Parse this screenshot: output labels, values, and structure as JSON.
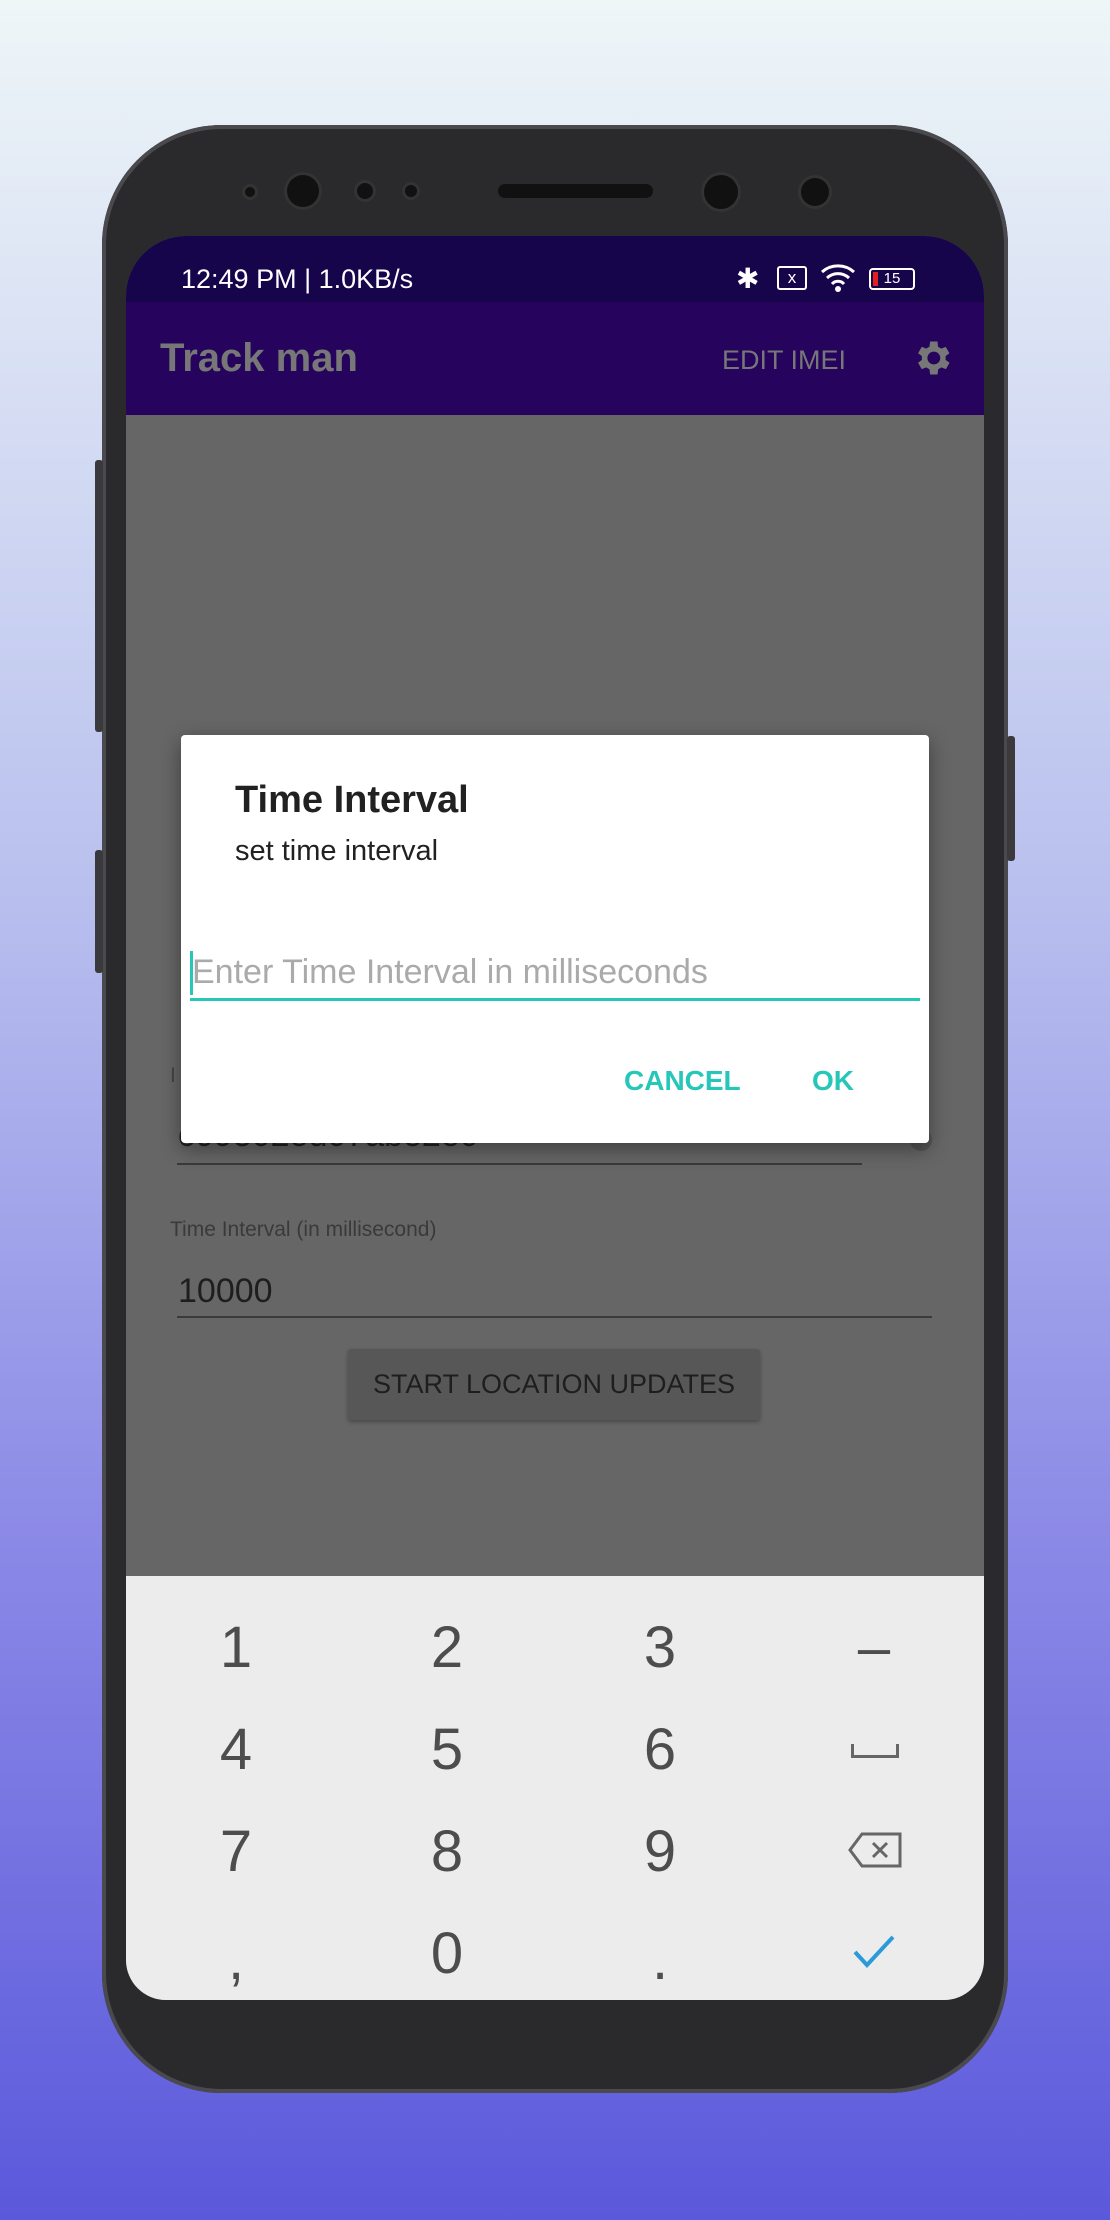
{
  "status_bar": {
    "time": "12:49 PM | 1.0KB/s",
    "battery": "15"
  },
  "app_bar": {
    "title": "Track man",
    "edit_imei": "EDIT IMEI",
    "settings_icon": "gear-icon"
  },
  "background_form": {
    "imei_label": "I",
    "imei_value": "c09802ed07abe2e0",
    "interval_label": "Time Interval (in millisecond)",
    "interval_value": "10000",
    "start_button": "START LOCATION UPDATES"
  },
  "dialog": {
    "title": "Time Interval",
    "message": "set time interval",
    "input_placeholder": "Enter Time Interval in milliseconds",
    "input_value": "",
    "cancel": "CANCEL",
    "ok": "OK",
    "accent_color": "#26c6b8"
  },
  "keyboard": {
    "rows": [
      [
        "1",
        "2",
        "3",
        "–"
      ],
      [
        "4",
        "5",
        "6",
        "space"
      ],
      [
        "7",
        "8",
        "9",
        "backspace"
      ],
      [
        ",",
        "0",
        ".",
        "done"
      ]
    ]
  }
}
